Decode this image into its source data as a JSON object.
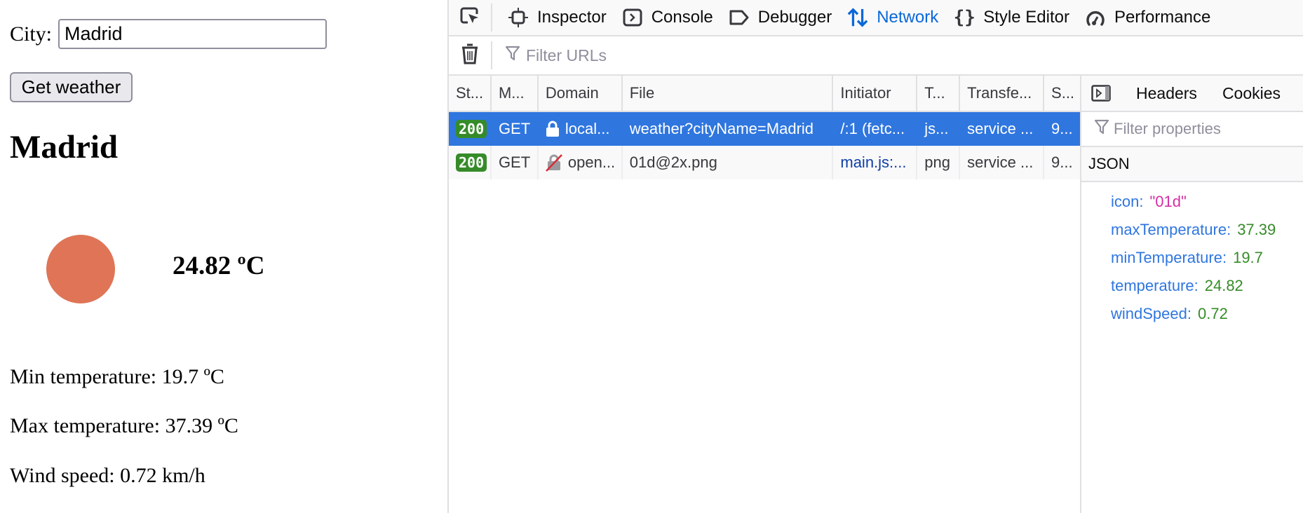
{
  "page": {
    "city_label": "City:",
    "city_input_value": "Madrid",
    "get_weather_label": "Get weather",
    "city_title": "Madrid",
    "weather_icon": "sun-icon",
    "sun_color": "#df7556",
    "temperature": "24.82 ºC",
    "min_temperature": "Min temperature: 19.7 ºC",
    "max_temperature": "Max temperature: 37.39 ºC",
    "wind_speed": "Wind speed: 0.72 km/h"
  },
  "devtools": {
    "toolbar": {
      "picker_icon": "element-picker-icon",
      "tabs": [
        {
          "label": "Inspector",
          "icon": "inspector-icon",
          "active": false
        },
        {
          "label": "Console",
          "icon": "console-icon",
          "active": false
        },
        {
          "label": "Debugger",
          "icon": "debugger-icon",
          "active": false
        },
        {
          "label": "Network",
          "icon": "network-icon",
          "active": true
        },
        {
          "label": "Style Editor",
          "icon": "style-editor-icon",
          "active": false
        },
        {
          "label": "Performance",
          "icon": "performance-icon",
          "active": false
        }
      ]
    },
    "filter": {
      "clear_icon": "trash-icon",
      "placeholder": "Filter URLs"
    },
    "columns": [
      "St...",
      "M...",
      "Domain",
      "File",
      "Initiator",
      "T...",
      "Transfe...",
      "S..."
    ],
    "requests": [
      {
        "status": "200",
        "method": "GET",
        "domain": "local...",
        "domain_icon": "lock-icon",
        "file": "weather?cityName=Madrid",
        "initiator": "/:1 (fetc...",
        "type": "js...",
        "transferred": "service ...",
        "size": "9...",
        "selected": true
      },
      {
        "status": "200",
        "method": "GET",
        "domain": "open...",
        "domain_icon": "insecure-lock-icon",
        "file": "01d@2x.png",
        "initiator": "main.js:...",
        "type": "png",
        "transferred": "service ...",
        "size": "9...",
        "selected": false
      }
    ],
    "side_panel": {
      "tabs": [
        "Headers",
        "Cookies"
      ],
      "filter_placeholder": "Filter properties",
      "section_title": "JSON",
      "json": [
        {
          "key": "icon:",
          "value": "\"01d\"",
          "kind": "string"
        },
        {
          "key": "maxTemperature:",
          "value": "37.39",
          "kind": "number"
        },
        {
          "key": "minTemperature:",
          "value": "19.7",
          "kind": "number"
        },
        {
          "key": "temperature:",
          "value": "24.82",
          "kind": "number"
        },
        {
          "key": "windSpeed:",
          "value": "0.72",
          "kind": "number"
        }
      ]
    },
    "colors": {
      "accent": "#0a68d9",
      "selected_row": "#2f76df",
      "status_ok": "#368b29",
      "json_key": "#2f76df",
      "json_string": "#d52fa4",
      "json_number": "#368b29"
    }
  }
}
